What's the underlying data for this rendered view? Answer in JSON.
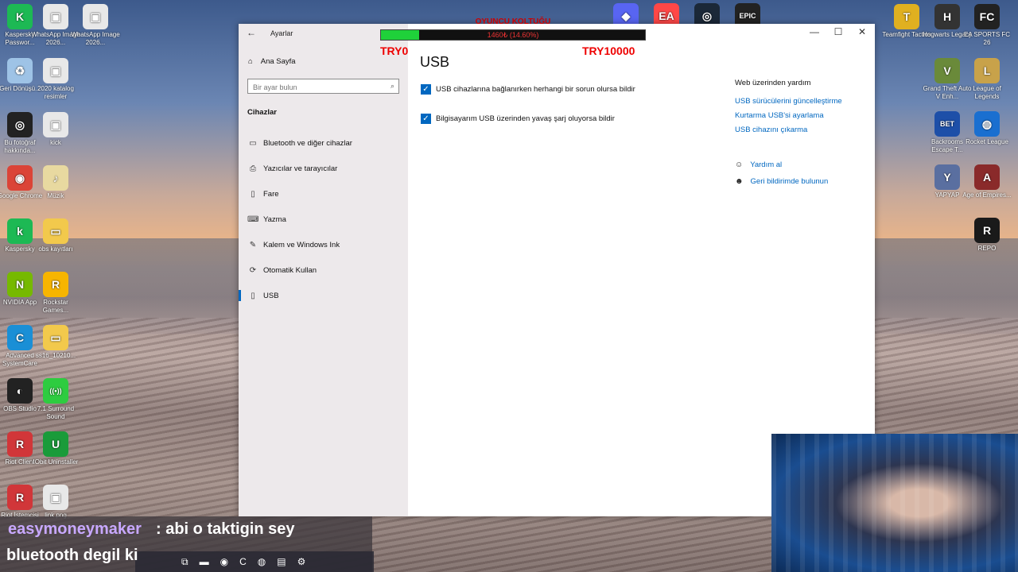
{
  "desktop": {
    "left_icons": [
      {
        "label": "Kaspersky Passwor...",
        "icon": "kaspersky-password-icon",
        "color": "#1db954",
        "glyph": "K"
      },
      {
        "label": "WhatsApp Image 2026...",
        "icon": "image-file-icon",
        "color": "#e8e8e8",
        "glyph": "▣"
      },
      {
        "label": "WhatsApp Image 2026...",
        "icon": "image-file-icon",
        "color": "#e8e8e8",
        "glyph": "▣"
      },
      {
        "label": "Geri Dönüşü...",
        "icon": "recycle-bin-icon",
        "color": "#9ec3e6",
        "glyph": "♻"
      },
      {
        "label": "2020 katalog resimler",
        "icon": "image-file-icon",
        "color": "#e8e8e8",
        "glyph": "▣"
      },
      {
        "label": "Bu fotoğraf hakkında...",
        "icon": "info-icon",
        "color": "#222",
        "glyph": "◎"
      },
      {
        "label": "kick",
        "icon": "image-file-icon",
        "color": "#e8e8e8",
        "glyph": "▣"
      },
      {
        "label": "Google Chrome",
        "icon": "chrome-icon",
        "color": "#db4437",
        "glyph": "◉"
      },
      {
        "label": "Müzik",
        "icon": "music-folder-icon",
        "color": "#e8d9a0",
        "glyph": "♪"
      },
      {
        "label": "Kaspersky",
        "icon": "kaspersky-icon",
        "color": "#1db954",
        "glyph": "k"
      },
      {
        "label": "obs kayıtları",
        "icon": "folder-icon",
        "color": "#f2c94c",
        "glyph": "▭"
      },
      {
        "label": "NVIDIA App",
        "icon": "nvidia-icon",
        "color": "#76b900",
        "glyph": "N"
      },
      {
        "label": "Rockstar Games...",
        "icon": "rockstar-icon",
        "color": "#f7b500",
        "glyph": "R"
      },
      {
        "label": "Advanced SystemCare",
        "icon": "systemcare-icon",
        "color": "#1a8fd6",
        "glyph": "C"
      },
      {
        "label": "ss16_10210...",
        "icon": "folder-icon",
        "color": "#f2c94c",
        "glyph": "▭"
      },
      {
        "label": "OBS Studio",
        "icon": "obs-icon",
        "color": "#222",
        "glyph": "◐"
      },
      {
        "label": "7.1 Surround Sound",
        "icon": "surround-icon",
        "color": "#2ecc40",
        "glyph": "((•))"
      },
      {
        "label": "Riot Client",
        "icon": "riot-icon",
        "color": "#d13639",
        "glyph": "R"
      },
      {
        "label": "IObit Uninstaller",
        "icon": "iobit-icon",
        "color": "#1a9b3a",
        "glyph": "U"
      },
      {
        "label": "Riot İstemcisi",
        "icon": "riot-icon",
        "color": "#d13639",
        "glyph": "R"
      },
      {
        "label": "link.png",
        "icon": "image-file-icon",
        "color": "#e8e8e8",
        "glyph": "▣"
      }
    ],
    "top_icons": [
      {
        "icon": "discord-icon",
        "color": "#5865f2",
        "glyph": "◆"
      },
      {
        "icon": "ea-icon",
        "color": "#ff4747",
        "glyph": "EA"
      },
      {
        "icon": "steam-icon",
        "color": "#1b2838",
        "glyph": "◎"
      },
      {
        "icon": "epic-games-icon",
        "color": "#222",
        "glyph": "EPIC"
      }
    ],
    "right_icons": [
      {
        "label": "Teamfight Tactics",
        "icon": "tft-icon",
        "color": "#e0b020",
        "glyph": "T"
      },
      {
        "label": "Hogwarts Legacy",
        "icon": "hogwarts-icon",
        "color": "#333",
        "glyph": "H"
      },
      {
        "label": "EA SPORTS FC 26",
        "icon": "fc26-icon",
        "color": "#222",
        "glyph": "FC"
      },
      {
        "label": "Grand Theft Auto V Enh...",
        "icon": "gta-icon",
        "color": "#6a8a3a",
        "glyph": "V"
      },
      {
        "label": "League of Legends",
        "icon": "lol-icon",
        "color": "#c8a24a",
        "glyph": "L"
      },
      {
        "label": "Backrooms Escape T...",
        "icon": "backrooms-icon",
        "color": "#1d4fa8",
        "glyph": "BET"
      },
      {
        "label": "Rocket League",
        "icon": "rocket-league-icon",
        "color": "#1a6fd0",
        "glyph": "◍"
      },
      {
        "label": "YAPYAP",
        "icon": "yapyap-icon",
        "color": "#5a6fa0",
        "glyph": "Y"
      },
      {
        "label": "Age of Empires...",
        "icon": "aoe-icon",
        "color": "#8a2a2a",
        "glyph": "A"
      },
      {
        "label": "REPO",
        "icon": "repo-icon",
        "color": "#1a1a1a",
        "glyph": "R"
      }
    ]
  },
  "settings": {
    "app_title": "Ayarlar",
    "home_label": "Ana Sayfa",
    "search_placeholder": "Bir ayar bulun",
    "section_title": "Cihazlar",
    "nav": [
      {
        "label": "Bluetooth ve diğer cihazlar",
        "icon": "bluetooth-icon",
        "glyph": "▭"
      },
      {
        "label": "Yazıcılar ve tarayıcılar",
        "icon": "printer-icon",
        "glyph": "⎙"
      },
      {
        "label": "Fare",
        "icon": "mouse-icon",
        "glyph": "▯"
      },
      {
        "label": "Yazma",
        "icon": "keyboard-icon",
        "glyph": "⌨"
      },
      {
        "label": "Kalem ve Windows Ink",
        "icon": "pen-icon",
        "glyph": "✎"
      },
      {
        "label": "Otomatik Kullan",
        "icon": "autoplay-icon",
        "glyph": "⟳"
      },
      {
        "label": "USB",
        "icon": "usb-icon",
        "glyph": "▯",
        "active": true
      }
    ],
    "page_title": "USB",
    "checkboxes": [
      {
        "label": "USB cihazlarına bağlanırken herhangi bir sorun olursa bildir",
        "checked": true
      },
      {
        "label": "Bilgisayarım USB üzerinden yavaş şarj oluyorsa bildir",
        "checked": true
      }
    ],
    "help_title": "Web üzerinden yardım",
    "help_links": [
      "USB sürücülerini güncelleştirme",
      "Kurtarma USB'si ayarlama",
      "USB cihazını çıkarma"
    ],
    "get_help": "Yardım al",
    "feedback": "Geri bildirimde bulunun"
  },
  "overlay": {
    "title": "OYUNCU KOLTUĞU",
    "progress_text": "1460₺ (14.60%)",
    "progress_fraction": 0.146,
    "min_label": "TRY0",
    "max_label": "TRY10000"
  },
  "chat": {
    "user": "easymoneymaker",
    "message_line1": ": abi o taktigin sey",
    "message_line2": "bluetooth degil ki"
  },
  "colors": {
    "accent": "#0067c0",
    "progress": "#1fd13a",
    "overlay_text": "#e00000"
  }
}
